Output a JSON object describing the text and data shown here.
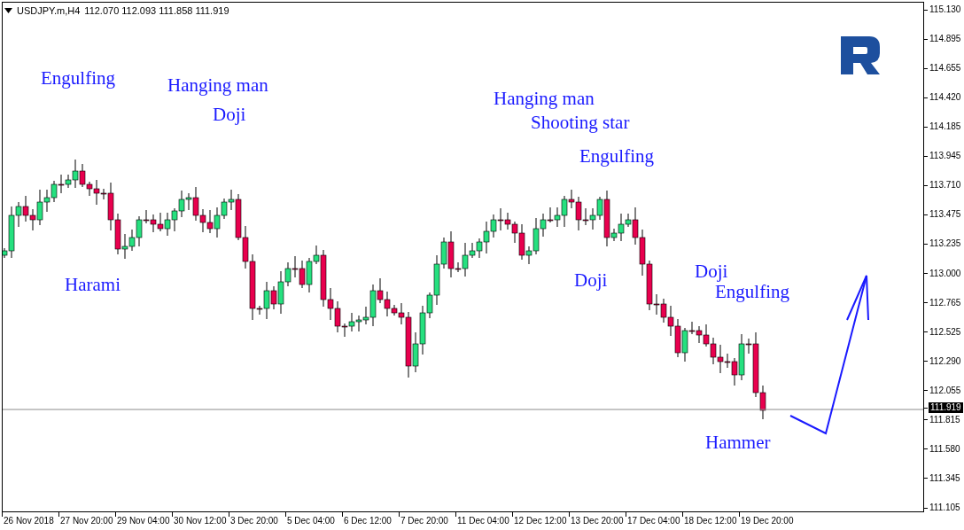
{
  "chart_header": {
    "symbol": "USDJPY.m,H4",
    "ohlc": [
      "112.070",
      "112.093",
      "111.858",
      "111.919"
    ]
  },
  "price_axis": {
    "ticks": [
      "115.130",
      "114.895",
      "114.655",
      "114.420",
      "114.185",
      "113.945",
      "113.710",
      "113.475",
      "113.235",
      "113.000",
      "112.765",
      "112.525",
      "112.290",
      "112.055",
      "111.815",
      "111.580",
      "111.345",
      "111.105"
    ],
    "current_price": "111.919"
  },
  "time_axis": {
    "ticks": [
      "26 Nov 2018",
      "27 Nov 20:00",
      "29 Nov 04:00",
      "30 Nov 12:00",
      "3 Dec 20:00",
      "5 Dec 04:00",
      "6 Dec 12:00",
      "7 Dec 20:00",
      "11 Dec 04:00",
      "12 Dec 12:00",
      "13 Dec 20:00",
      "17 Dec 04:00",
      "18 Dec 12:00",
      "19 Dec 20:00"
    ]
  },
  "annotations": [
    {
      "label": "Engulfing"
    },
    {
      "label": "Hanging man"
    },
    {
      "label": "Doji"
    },
    {
      "label": "Harami"
    },
    {
      "label": "Hanging man"
    },
    {
      "label": "Shooting star"
    },
    {
      "label": "Engulfing"
    },
    {
      "label": "Doji"
    },
    {
      "label": "Doji"
    },
    {
      "label": "Engulfing"
    },
    {
      "label": "Hammer"
    }
  ]
}
